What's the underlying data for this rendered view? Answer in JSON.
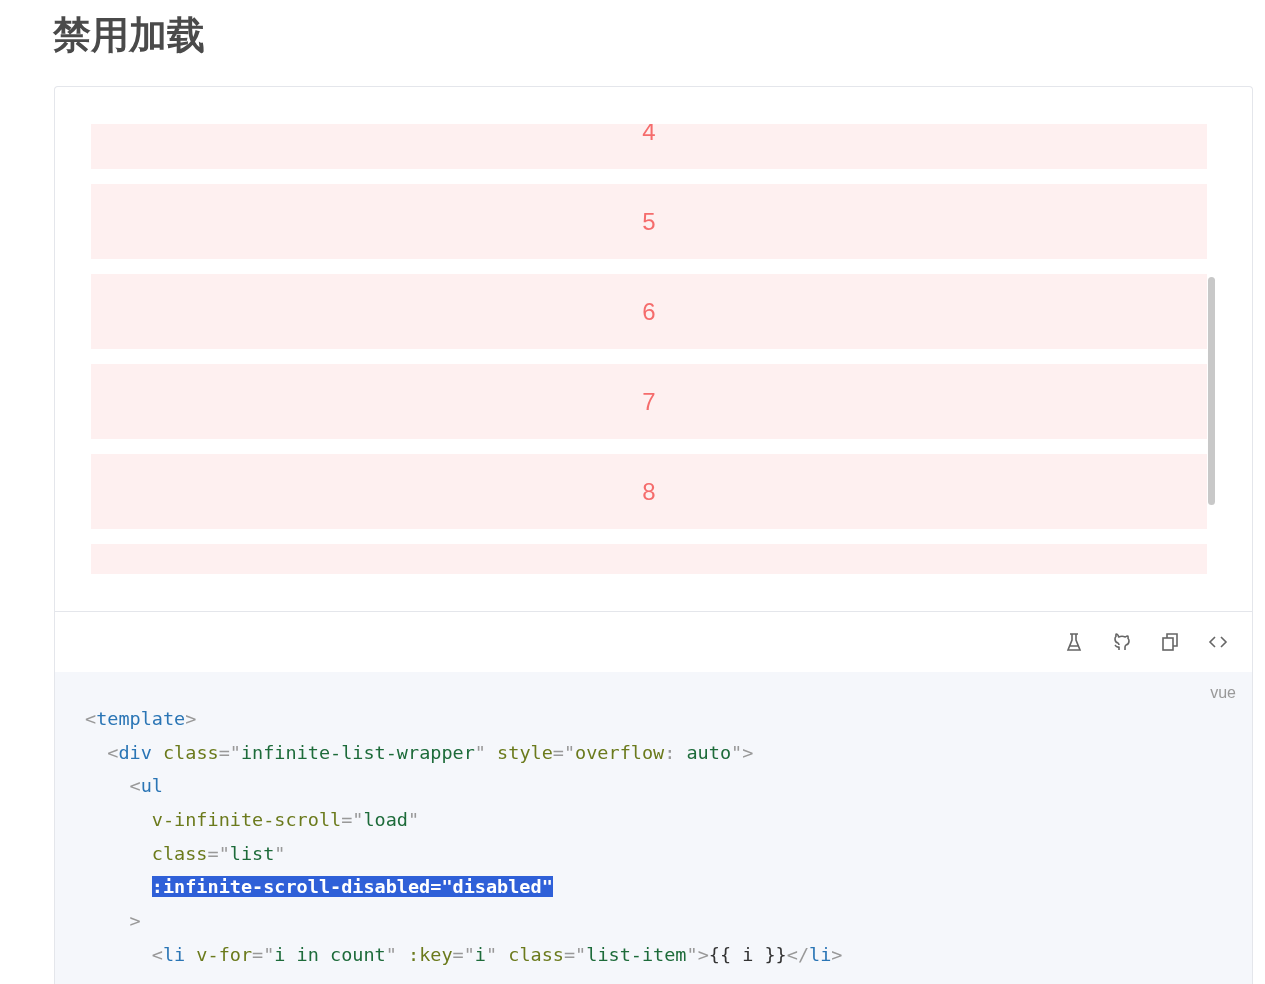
{
  "title": "禁用加载",
  "list": {
    "items": [
      {
        "kind": "full",
        "label": "4"
      },
      {
        "kind": "full",
        "label": "5"
      },
      {
        "kind": "full",
        "label": "6"
      },
      {
        "kind": "full",
        "label": "7"
      },
      {
        "kind": "full",
        "label": "8"
      },
      {
        "kind": "cut"
      }
    ]
  },
  "toolbar": {
    "icons": [
      {
        "kind": "flask"
      },
      {
        "kind": "github"
      },
      {
        "kind": "copy"
      },
      {
        "kind": "code"
      }
    ]
  },
  "code": {
    "language": "vue",
    "lines": [
      {
        "tokens": [
          {
            "t": "<",
            "kind": "punct"
          },
          {
            "t": "template",
            "kind": "tag"
          },
          {
            "t": ">",
            "kind": "punct"
          }
        ],
        "children": [
          {
            "tokens": [
              {
                "t": "<",
                "kind": "punct"
              },
              {
                "t": "div",
                "kind": "tag"
              },
              {
                "t": " class",
                "kind": "attr"
              },
              {
                "t": "=\"",
                "kind": "punct"
              },
              {
                "t": "infinite-list-wrapper",
                "kind": "str"
              },
              {
                "t": "\"",
                "kind": "punct"
              },
              {
                "t": " style",
                "kind": "attr"
              },
              {
                "t": "=\"",
                "kind": "punct"
              },
              {
                "t": "overflow",
                "kind": "attr"
              },
              {
                "t": ": ",
                "kind": "punct"
              },
              {
                "t": "auto",
                "kind": "str"
              },
              {
                "t": "\">",
                "kind": "punct"
              }
            ],
            "children": [
              {
                "tokens": [
                  {
                    "t": "<",
                    "kind": "punct"
                  },
                  {
                    "t": "ul",
                    "kind": "tag"
                  }
                ],
                "children": [
                  {
                    "tokens": [
                      {
                        "t": "v-infinite-scroll",
                        "kind": "attr"
                      },
                      {
                        "t": "=\"",
                        "kind": "punct"
                      },
                      {
                        "t": "load",
                        "kind": "str"
                      },
                      {
                        "t": "\"",
                        "kind": "punct"
                      }
                    ]
                  },
                  {
                    "tokens": [
                      {
                        "t": "class",
                        "kind": "attr"
                      },
                      {
                        "t": "=\"",
                        "kind": "punct"
                      },
                      {
                        "t": "list",
                        "kind": "str"
                      },
                      {
                        "t": "\"",
                        "kind": "punct"
                      }
                    ]
                  },
                  {
                    "tokens": [
                      {
                        "t": ":infinite-scroll-disabled=\"disabled\"",
                        "kind": "selected"
                      }
                    ]
                  }
                ]
              },
              {
                "tokens": [
                  {
                    "t": ">",
                    "kind": "punct"
                  }
                ],
                "children": [
                  {
                    "tokens": [
                      {
                        "t": "<",
                        "kind": "punct"
                      },
                      {
                        "t": "li",
                        "kind": "tag"
                      },
                      {
                        "t": " v-for",
                        "kind": "attr"
                      },
                      {
                        "t": "=\"",
                        "kind": "punct"
                      },
                      {
                        "t": "i in count",
                        "kind": "str"
                      },
                      {
                        "t": "\"",
                        "kind": "punct"
                      },
                      {
                        "t": " :key",
                        "kind": "attr"
                      },
                      {
                        "t": "=\"",
                        "kind": "punct"
                      },
                      {
                        "t": "i",
                        "kind": "str"
                      },
                      {
                        "t": "\"",
                        "kind": "punct"
                      },
                      {
                        "t": " class",
                        "kind": "attr"
                      },
                      {
                        "t": "=\"",
                        "kind": "punct"
                      },
                      {
                        "t": "list-item",
                        "kind": "str"
                      },
                      {
                        "t": "\">",
                        "kind": "punct"
                      },
                      {
                        "t": "{{ i }}",
                        "kind": "plain"
                      },
                      {
                        "t": "</",
                        "kind": "punct"
                      },
                      {
                        "t": "li",
                        "kind": "tag"
                      },
                      {
                        "t": ">",
                        "kind": "punct"
                      }
                    ]
                  }
                ]
              }
            ]
          }
        ]
      }
    ]
  }
}
